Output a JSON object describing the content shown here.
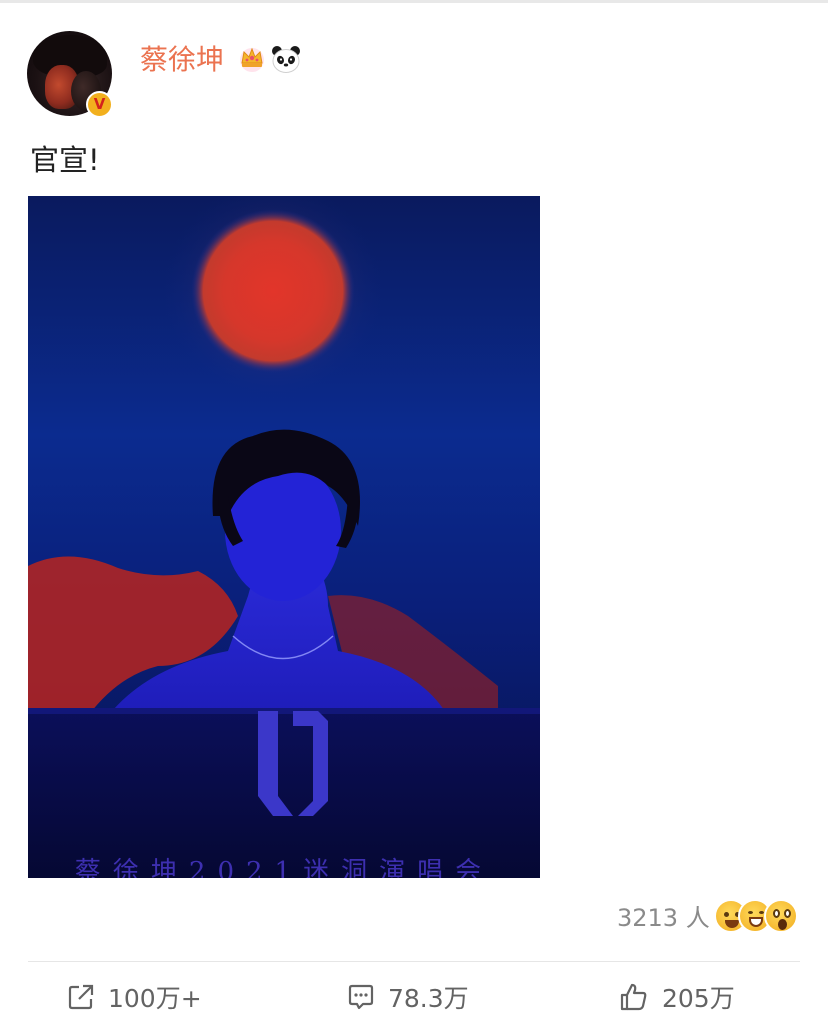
{
  "post": {
    "author": "蔡徐坤",
    "verified_mark": "V",
    "text": "官宣!",
    "image_caption": "蔡徐坤2021迷洞演唱会",
    "image_mark": "迷"
  },
  "reactions": {
    "count": "3213 人",
    "emojis": [
      "smile-icon",
      "laugh-icon",
      "surprised-icon"
    ]
  },
  "actions": {
    "repost_count": "100万+",
    "comment_count": "78.3万",
    "like_count": "205万"
  },
  "colors": {
    "username": "#eb7350",
    "verified_badge": "#f2b01e",
    "action_text": "#636363"
  }
}
